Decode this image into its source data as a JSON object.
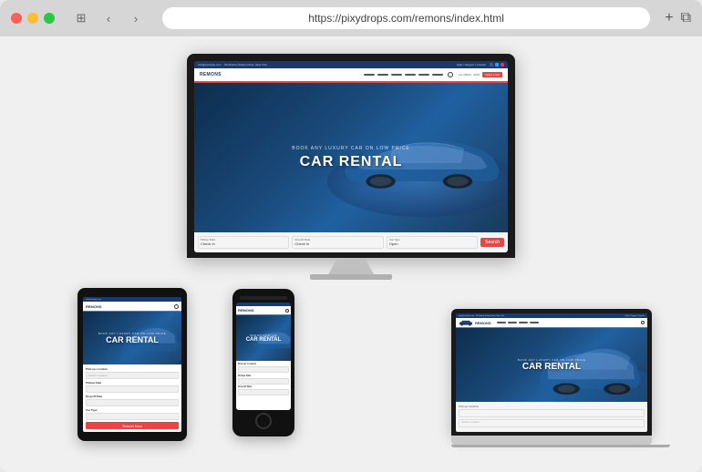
{
  "browser": {
    "url": "https://pixydrops.com/remons/index.html",
    "traffic_lights": [
      "red",
      "yellow",
      "green"
    ]
  },
  "site": {
    "brand": "REMONS",
    "topbar_text": "info@example.com   96 Windup Station Drive, New York",
    "hero_subtitle": "BOOK ANY LUXURY CAR ON LOW PRICE",
    "hero_title": "CAR RENTAL",
    "nav_items": [
      "Home",
      "About Us",
      "Pages",
      "Cars",
      "Blog",
      "Contact"
    ],
    "cta_label": "Order a Car",
    "booking_fields": [
      {
        "label": "Pickup Date",
        "placeholder": "Check In"
      },
      {
        "label": "Dropoff Date",
        "placeholder": "Check In"
      },
      {
        "label": "Car Type",
        "placeholder": "Open"
      }
    ],
    "form_labels": {
      "pickup_location": "Pick-up Location",
      "pickup_date": "Pickup Date",
      "dropoff_date": "Dropoff Date",
      "car_type": "Car Type",
      "btn_search": "Search Now"
    }
  }
}
